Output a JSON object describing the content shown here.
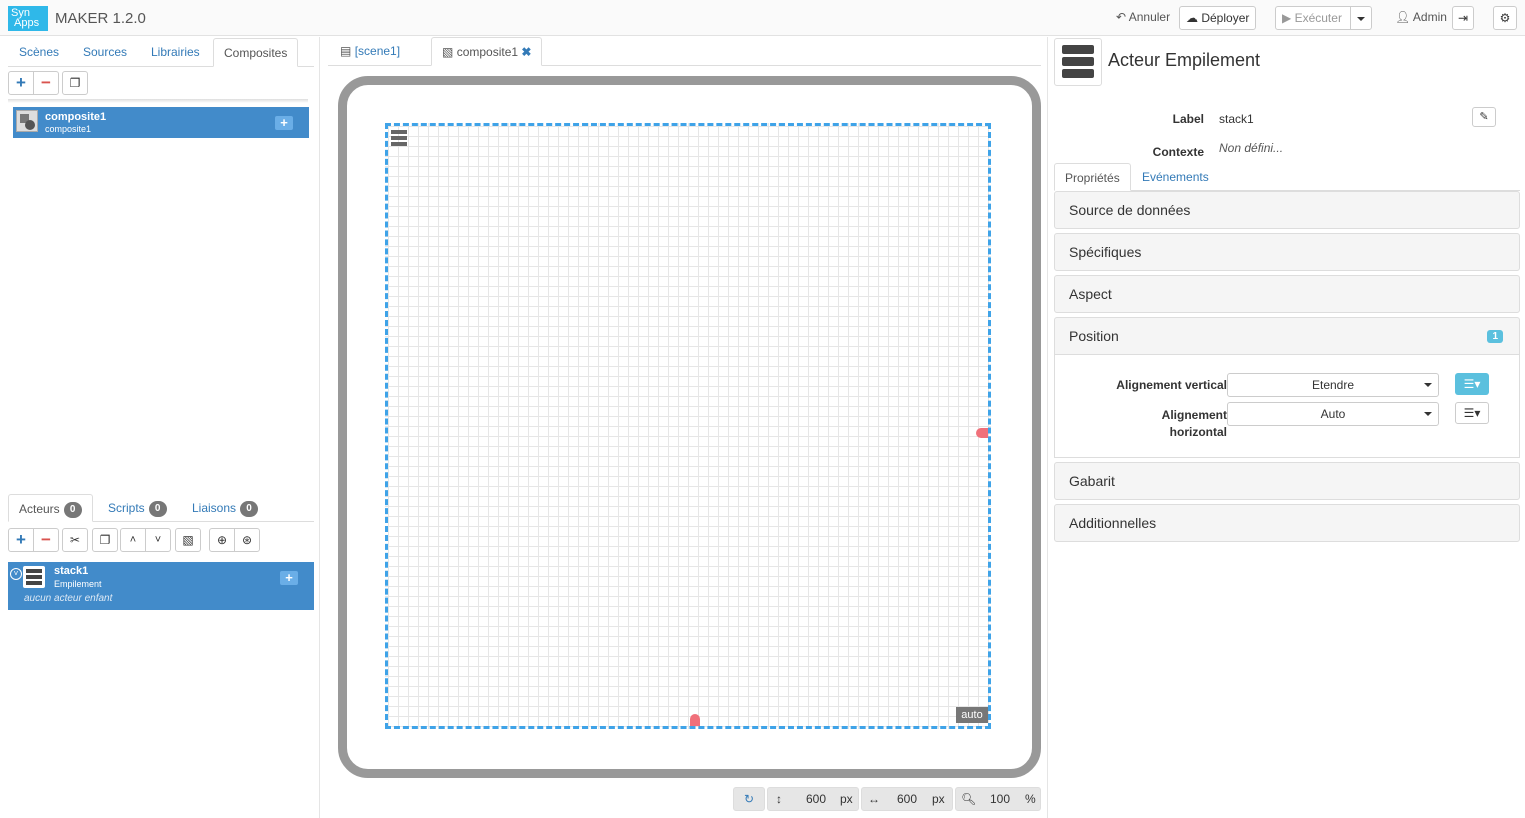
{
  "topbar": {
    "logo_line1": "Syn",
    "logo_line2": "Apps",
    "app_name": "MAKER  1.2.0",
    "undo_label": "Annuler",
    "deploy_label": "Déployer",
    "run_label": "Exécuter",
    "user_label": "Admin"
  },
  "left": {
    "tabs": [
      "Scènes",
      "Sources",
      "Librairies",
      "Composites"
    ],
    "active_tab": "Composites",
    "composite": {
      "title": "composite1",
      "subtitle": "composite1"
    },
    "actor_tabs": [
      {
        "label": "Acteurs",
        "count": "0"
      },
      {
        "label": "Scripts",
        "count": "0"
      },
      {
        "label": "Liaisons",
        "count": "0"
      }
    ],
    "actor": {
      "title": "stack1",
      "subtitle": "Empilement",
      "note": "aucun acteur enfant"
    }
  },
  "center": {
    "tabs": [
      {
        "label": "[scene1]",
        "active": false
      },
      {
        "label": "composite1",
        "active": true
      }
    ],
    "canvas_badge": "auto",
    "height_value": "600",
    "height_unit": "px",
    "width_value": "600",
    "width_unit": "px",
    "zoom_value": "100",
    "zoom_unit": "%"
  },
  "right": {
    "title": "Acteur Empilement",
    "label_key": "Label",
    "label_value": "stack1",
    "context_key": "Contexte",
    "context_value": "Non défini...",
    "tabs": [
      "Propriétés",
      "Evénements"
    ],
    "sections": {
      "datasource": "Source de données",
      "specifics": "Spécifiques",
      "aspect": "Aspect",
      "position": "Position",
      "position_badge": "1",
      "template": "Gabarit",
      "additional": "Additionnelles"
    },
    "valign_label": "Alignement vertical",
    "valign_value": "Etendre",
    "halign_label_1": "Alignement",
    "halign_label_2": "horizontal",
    "halign_value": "Auto"
  },
  "colors": {
    "accent": "#428bca",
    "selection": "#3fa3e8",
    "handle": "#f0707a"
  }
}
